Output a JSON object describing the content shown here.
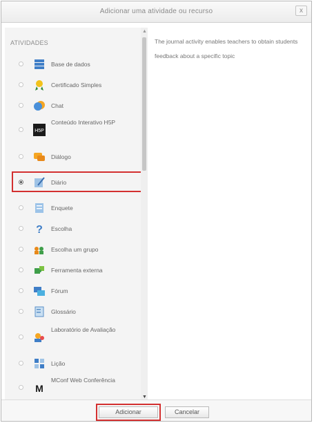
{
  "dialog": {
    "title": "Adicionar uma atividade ou recurso",
    "close_label": "x"
  },
  "list": {
    "heading": "ATIVIDADES",
    "items": [
      {
        "label": "Base de dados",
        "icon": "database-icon",
        "selected": false
      },
      {
        "label": "Certificado Simples",
        "icon": "certificate-icon",
        "selected": false
      },
      {
        "label": "Chat",
        "icon": "chat-icon",
        "selected": false
      },
      {
        "label": "Conteúdo Interativo H5P",
        "icon": "h5p-icon",
        "selected": false
      },
      {
        "label": "Diálogo",
        "icon": "dialogue-icon",
        "selected": false
      },
      {
        "label": "Diário",
        "icon": "journal-icon",
        "selected": true
      },
      {
        "label": "Enquete",
        "icon": "poll-icon",
        "selected": false
      },
      {
        "label": "Escolha",
        "icon": "choice-icon",
        "selected": false
      },
      {
        "label": "Escolha um grupo",
        "icon": "group-choice-icon",
        "selected": false
      },
      {
        "label": "Ferramenta externa",
        "icon": "puzzle-icon",
        "selected": false
      },
      {
        "label": "Fórum",
        "icon": "forum-icon",
        "selected": false
      },
      {
        "label": "Glossário",
        "icon": "glossary-icon",
        "selected": false
      },
      {
        "label": "Laboratório de Avaliação",
        "icon": "workshop-icon",
        "selected": false
      },
      {
        "label": "Lição",
        "icon": "lesson-icon",
        "selected": false
      },
      {
        "label": "MConf Web Conferência",
        "icon": "mconf-icon",
        "selected": false
      }
    ]
  },
  "description": {
    "text": "The journal activity enables teachers to obtain students feedback about a specific topic"
  },
  "footer": {
    "add_label": "Adicionar",
    "cancel_label": "Cancelar"
  },
  "colors": {
    "highlight": "#d32f2f",
    "pane_background": "#f4f4f4"
  }
}
